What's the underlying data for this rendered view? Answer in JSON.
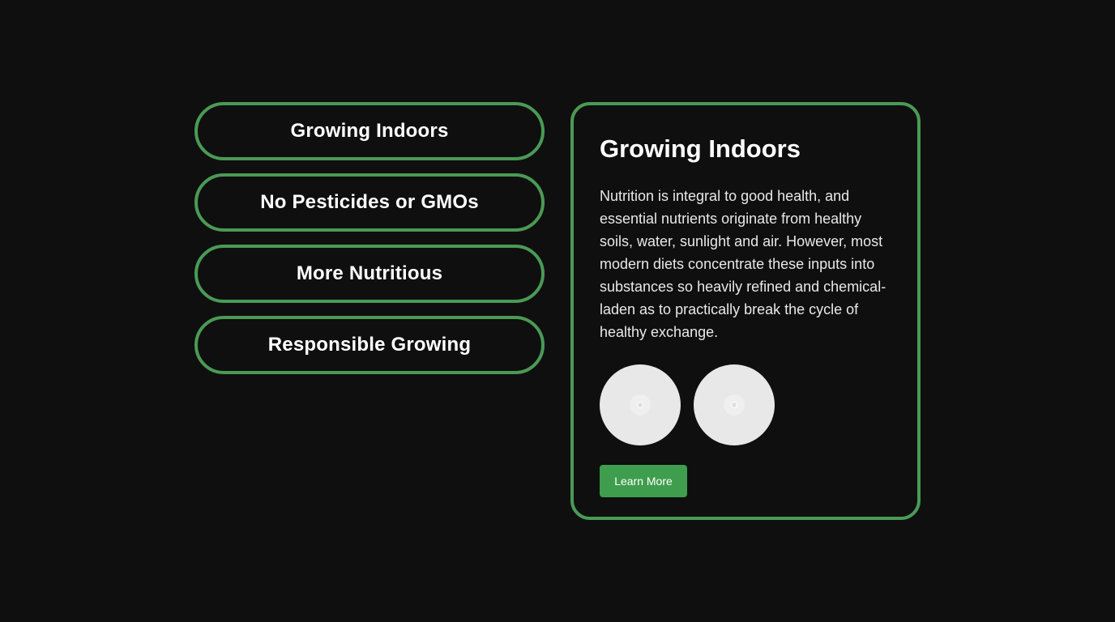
{
  "tabs": [
    {
      "label": "Growing Indoors"
    },
    {
      "label": "No Pesticides or GMOs"
    },
    {
      "label": "More Nutritious"
    },
    {
      "label": "Responsible Growing"
    }
  ],
  "panel": {
    "title": "Growing Indoors",
    "body": "Nutrition is integral to good health, and essential nutrients originate from healthy soils, water, sunlight and air. However, most modern diets concentrate these inputs into substances so heavily refined and chemical-laden as to practically break the cycle of healthy exchange.",
    "images": [
      {
        "icon": "image-placeholder-icon"
      },
      {
        "icon": "image-placeholder-icon"
      }
    ],
    "button_label": "Learn More"
  },
  "colors": {
    "background": "#0f0f0f",
    "accent": "#4a9a55",
    "button": "#3f9e4d",
    "text": "#ffffff"
  }
}
